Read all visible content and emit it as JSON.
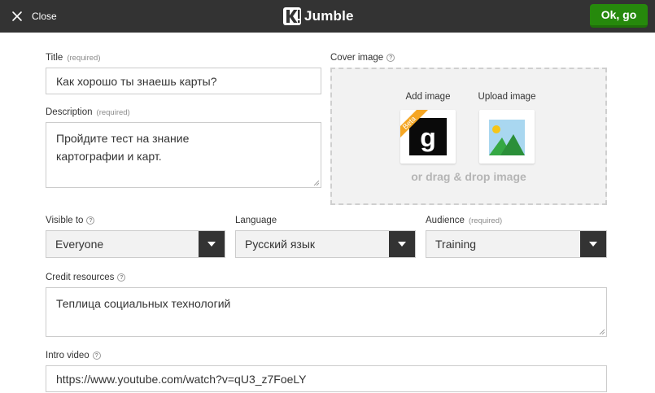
{
  "header": {
    "close_label": "Close",
    "brand": "Jumble",
    "ok_label": "Ok, go"
  },
  "form": {
    "title": {
      "label": "Title",
      "required": "(required)",
      "value": "Как хорошо ты знаешь карты?"
    },
    "description": {
      "label": "Description",
      "required": "(required)",
      "value_line1": "Пройдите тест на знание",
      "value_line2": "картографии и карт."
    },
    "cover": {
      "label": "Cover image",
      "add_label": "Add image",
      "upload_label": "Upload image",
      "beta_badge": "Beta",
      "getty_letter": "g",
      "drag_text": "or drag & drop image"
    },
    "visible_to": {
      "label": "Visible to",
      "value": "Everyone"
    },
    "language": {
      "label": "Language",
      "value": "Русский язык"
    },
    "audience": {
      "label": "Audience",
      "required": "(required)",
      "value": "Training"
    },
    "credit": {
      "label": "Credit resources",
      "value": "Теплица социальных технологий"
    },
    "intro_video": {
      "label": "Intro video",
      "value": "https://www.youtube.com/watch?v=qU3_z7FoeLY"
    }
  },
  "colors": {
    "topbar": "#333333",
    "ok_button": "#26890c",
    "select_arrow_bg": "#333333",
    "beta_badge": "#f5a623"
  }
}
